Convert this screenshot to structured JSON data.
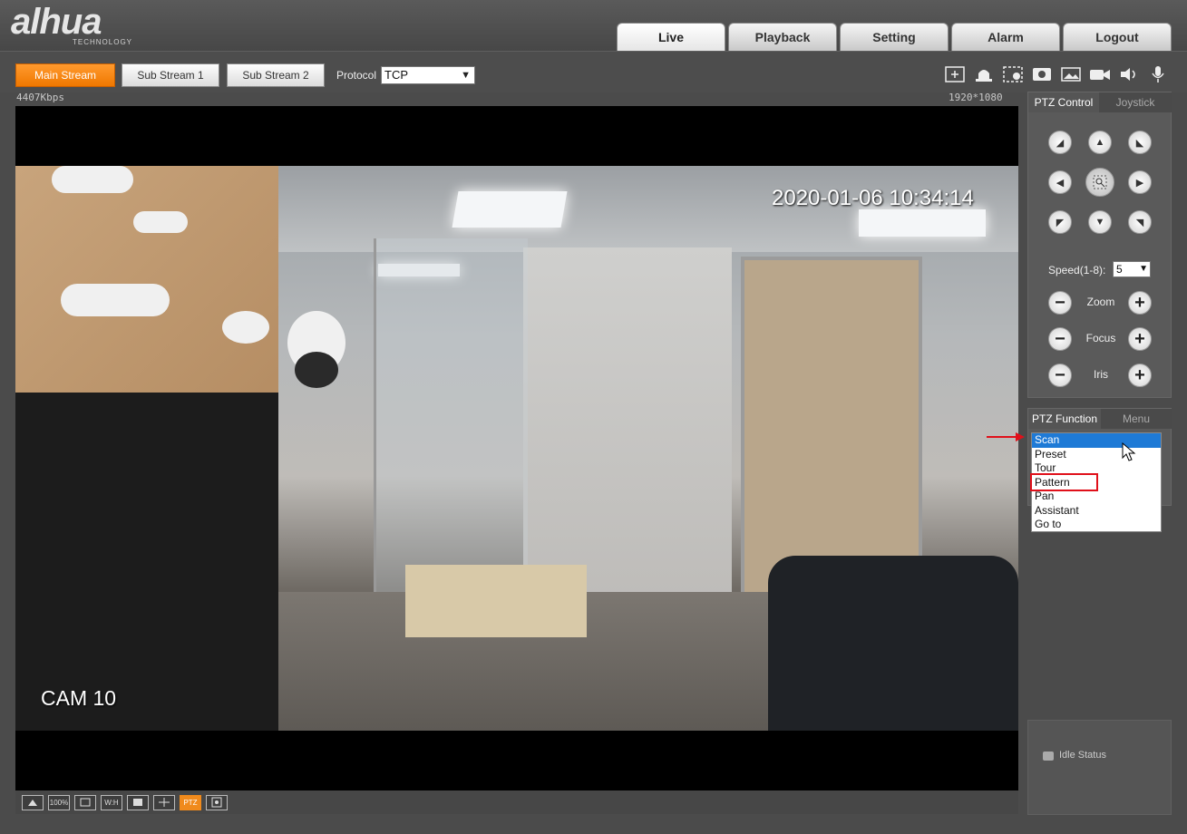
{
  "brand": {
    "name": "alhua",
    "sub": "TECHNOLOGY"
  },
  "nav": {
    "tabs": [
      {
        "label": "Live"
      },
      {
        "label": "Playback"
      },
      {
        "label": "Setting"
      },
      {
        "label": "Alarm"
      },
      {
        "label": "Logout"
      }
    ],
    "active": "Live"
  },
  "toolbar": {
    "streams": [
      "Main Stream",
      "Sub Stream 1",
      "Sub Stream 2"
    ],
    "active_stream": "Main Stream",
    "protocol_label": "Protocol",
    "protocol_value": "TCP",
    "icons": [
      "zoom-region-icon",
      "alarm-bell-icon",
      "snapshot-region-icon",
      "record-icon",
      "image-icon",
      "video-camera-icon",
      "speaker-icon",
      "microphone-icon"
    ]
  },
  "video": {
    "bitrate": "4407Kbps",
    "resolution": "1920*1080",
    "timestamp": "2020-01-06 10:34:14",
    "channel_name": "CAM 10"
  },
  "bottom_bar": {
    "buttons": [
      "crop-icon",
      "100%",
      "fit-icon",
      "W:H",
      "ratio-icon",
      "grid-icon",
      "PTZ",
      "focus-icon"
    ],
    "active": "PTZ"
  },
  "ptz_control": {
    "tabs": [
      "PTZ Control",
      "Joystick"
    ],
    "speed_label": "Speed(1-8):",
    "speed_value": "5",
    "zoom_label": "Zoom",
    "focus_label": "Focus",
    "iris_label": "Iris"
  },
  "ptz_function": {
    "tabs": [
      "PTZ Function",
      "Menu"
    ],
    "options": [
      "Scan",
      "Preset",
      "Tour",
      "Pattern",
      "Pan",
      "Assistant",
      "Go to"
    ],
    "selected": "Scan",
    "highlighted": "Pattern"
  },
  "status": {
    "text": "Idle Status"
  },
  "colors": {
    "accent": "#f07800",
    "selection": "#1e7ad6",
    "annotation": "#e0101a"
  }
}
